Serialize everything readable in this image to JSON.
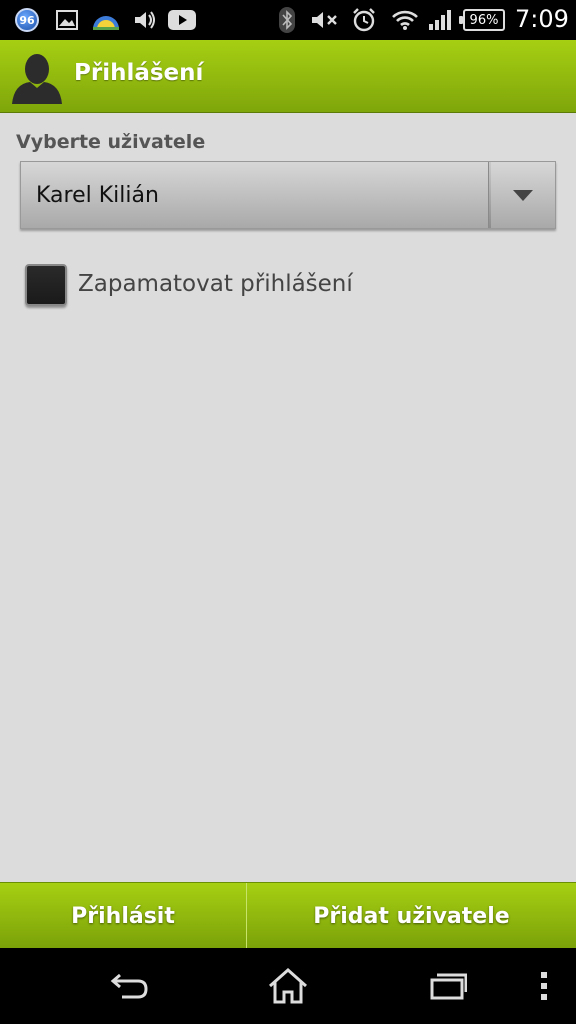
{
  "status_bar": {
    "notification_badge": "96",
    "battery": "96%",
    "time": "7:09"
  },
  "header": {
    "title": "Přihlášení"
  },
  "form": {
    "user_label": "Vyberte uživatele",
    "selected_user": "Karel Kilián",
    "remember_label": "Zapamatovat přihlášení",
    "remember_checked": false
  },
  "actions": {
    "login": "Přihlásit",
    "add_user": "Přidat uživatele"
  },
  "colors": {
    "accent_green": "#8fbc0c",
    "background": "#dcdcdc"
  }
}
